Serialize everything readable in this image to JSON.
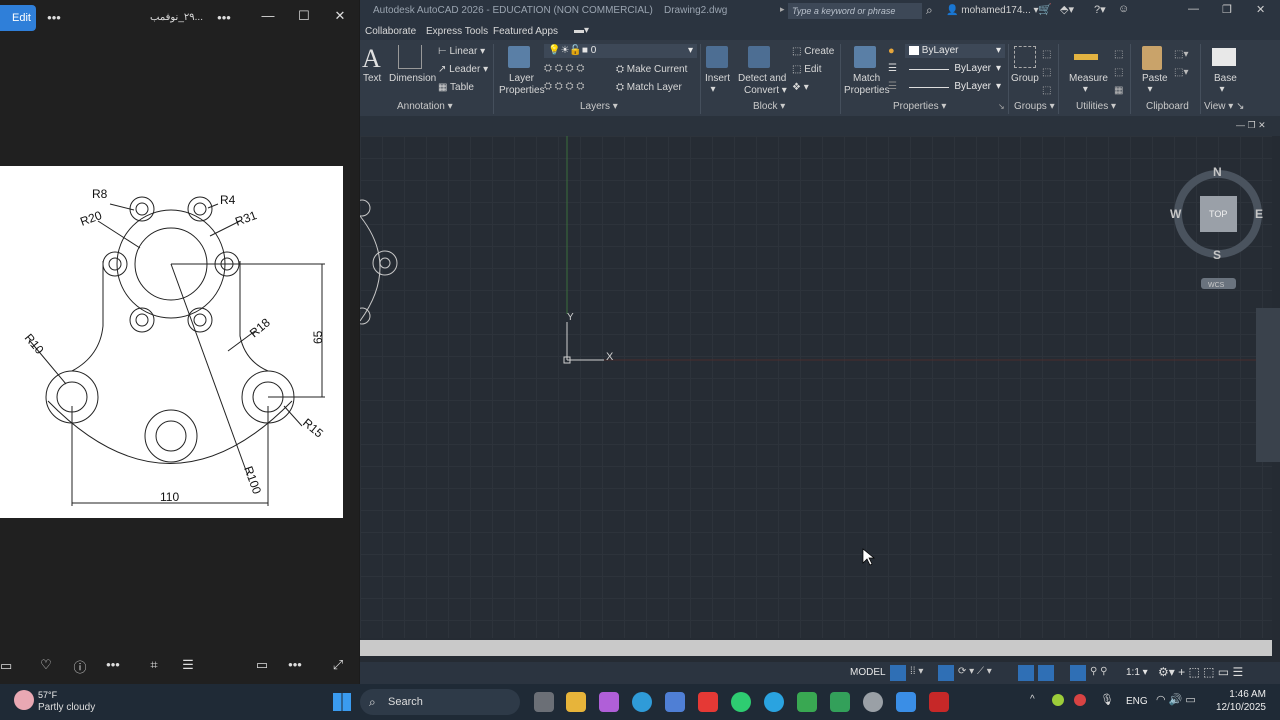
{
  "viewer": {
    "edit_label": "Edit",
    "title": "٢٩_نوفمب...",
    "drawing_labels": {
      "r8": "R8",
      "r4": "R4",
      "r20": "R20",
      "r31": "R31",
      "r10": "R10",
      "r18": "R18",
      "d65": "65",
      "r15": "R15",
      "r100": "R100",
      "d110": "110"
    }
  },
  "acad": {
    "title": "Autodesk AutoCAD 2026 - EDUCATION (NON COMMERCIAL)    Drawing2.dwg",
    "search_placeholder": "Type a keyword or phrase",
    "user": "mohamed174...",
    "menu": [
      "Collaborate",
      "Express Tools",
      "Featured Apps"
    ],
    "ribbon": {
      "text": "Text",
      "dimension": "Dimension",
      "linear": "Linear",
      "leader": "Leader",
      "table": "Table",
      "annotation": "Annotation",
      "layer_properties_1": "Layer",
      "layer_properties_2": "Properties",
      "layer_value": "0",
      "make_current": "Make Current",
      "match_layer": "Match Layer",
      "layers": "Layers",
      "insert": "Insert",
      "detect_1": "Detect and",
      "detect_2": "Convert",
      "create": "Create",
      "edit": "Edit",
      "block": "Block",
      "match_props_1": "Match",
      "match_props_2": "Properties",
      "bylayer": "ByLayer",
      "bylayer_line": "ByLayer",
      "bylayer_line2": "ByLayer",
      "properties": "Properties",
      "group": "Group",
      "groups": "Groups",
      "measure": "Measure",
      "utilities": "Utilities",
      "paste": "Paste",
      "clipboard": "Clipboard",
      "base": "Base",
      "view": "View"
    },
    "viewcube": {
      "n": "N",
      "s": "S",
      "e": "E",
      "w": "W",
      "top": "TOP",
      "wcs": "WCS"
    },
    "ucs": {
      "x": "X",
      "y": "Y"
    },
    "status": {
      "model": "MODEL",
      "scale": "1:1"
    }
  },
  "taskbar": {
    "temp": "57°F",
    "weather": "Partly cloudy",
    "search": "Search",
    "lang": "ENG",
    "time": "1:46 AM",
    "date": "12/10/2025"
  }
}
